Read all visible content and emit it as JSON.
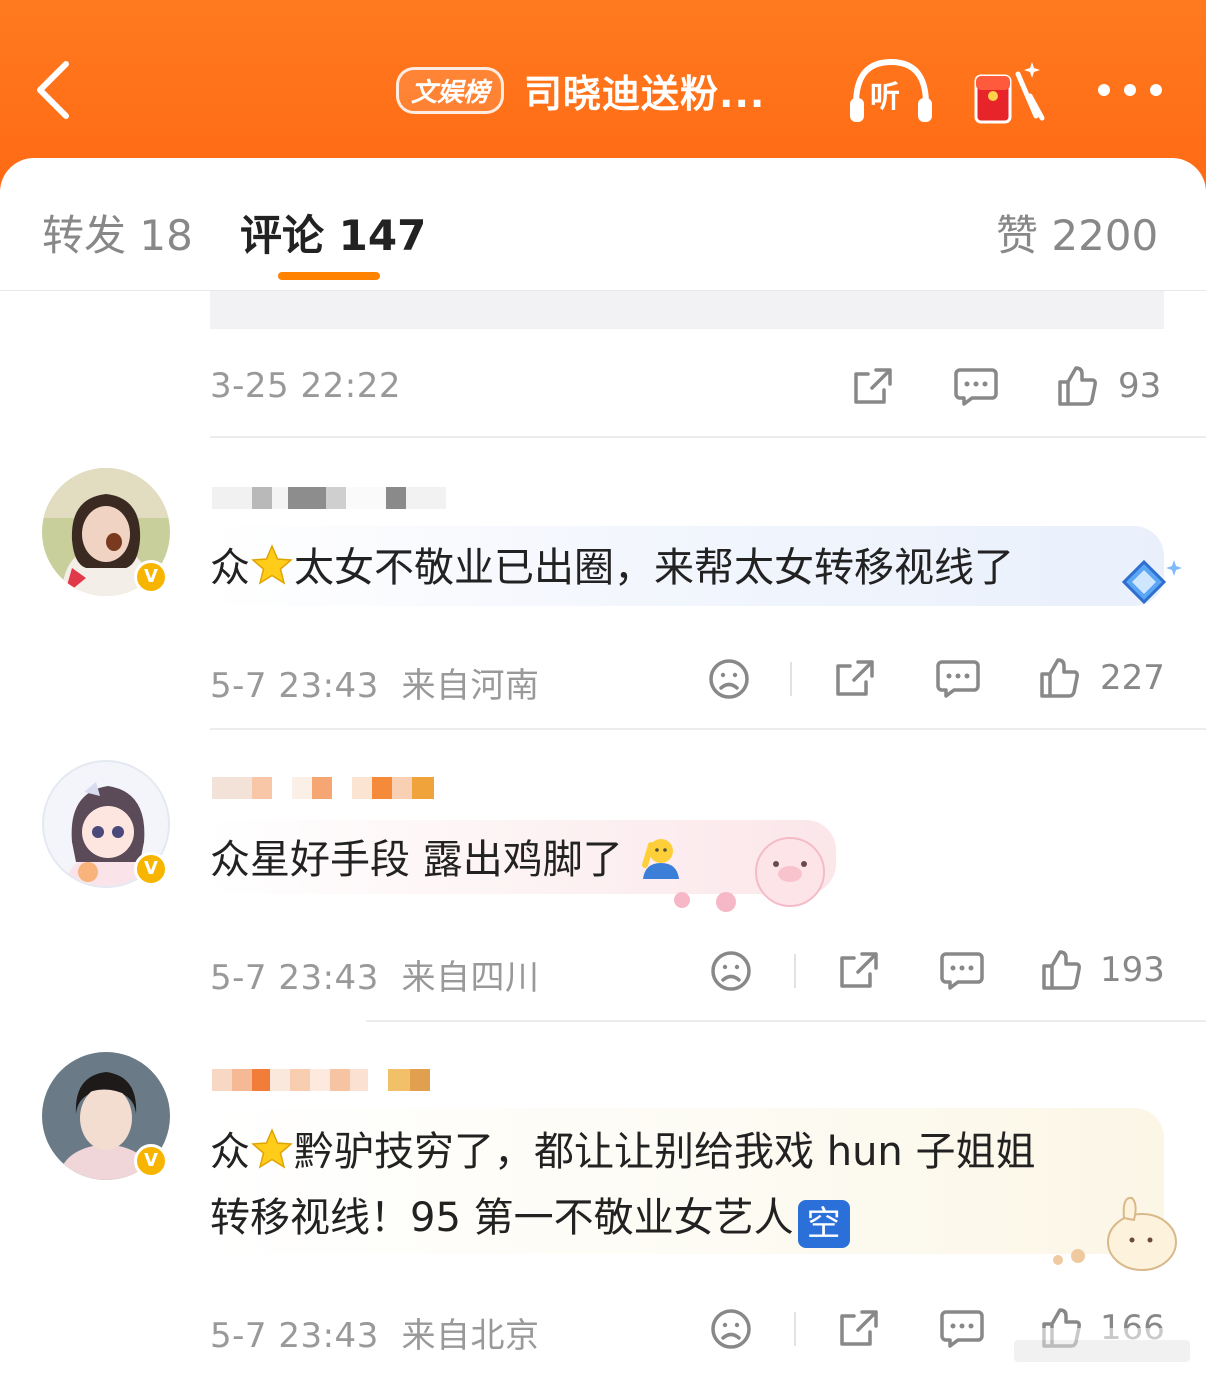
{
  "header": {
    "badge": "文娱榜",
    "title": "司晓迪送粉...",
    "listen_label": "听",
    "colors": {
      "brand": "#ff7020",
      "accent": "#ff8200",
      "vip": "#f7b500"
    }
  },
  "tabs": [
    {
      "label": "转发 18"
    },
    {
      "label": "评论 147"
    },
    {
      "label": "赞 2200"
    }
  ],
  "top_meta": {
    "time": "3-25 22:22",
    "likes": "93"
  },
  "comments": [
    {
      "text_before": "众",
      "text_after": "太女不敬业已出圈，来帮太女转移视线了",
      "time": "5-7 23:43",
      "location": "来自河南",
      "likes": "227"
    },
    {
      "text": "众星好手段 露出鸡脚了",
      "time": "5-7 23:43",
      "location": "来自四川",
      "likes": "193"
    },
    {
      "line1_before": "众",
      "line1_after": "黔驴技穷了，都让让别给我戏 hun 子姐姐",
      "line2": "转移视线！95 第一不敬业女艺人",
      "emoji_label": "空",
      "time": "5-7 23:43",
      "location": "来自北京",
      "likes": "166"
    }
  ]
}
